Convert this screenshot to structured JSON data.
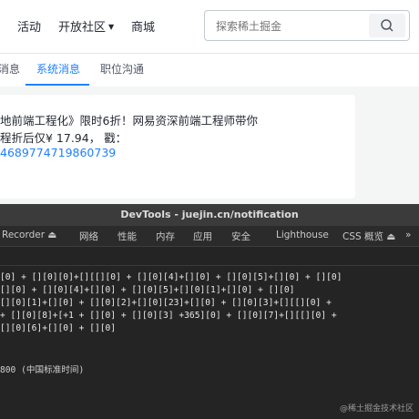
{
  "topnav": {
    "items": [
      {
        "label": "活动"
      },
      {
        "label": "开放社区"
      },
      {
        "label": "商城"
      }
    ],
    "search_placeholder": "探索稀土掘金"
  },
  "subnav": {
    "tabs": [
      {
        "label": "消息",
        "active": false
      },
      {
        "label": "系统消息",
        "active": true
      },
      {
        "label": "职位沟通",
        "active": false
      }
    ]
  },
  "card": {
    "line1": "地前端工程化》限时6折！网易资深前端工程师带你",
    "line2": "程折后仅¥ 17.94， 戳：",
    "link": "4689774719860739"
  },
  "devtools": {
    "title": "DevTools - juejin.cn/notification",
    "tabs": [
      {
        "label": "Recorder ⏏"
      },
      {
        "label": "网络"
      },
      {
        "label": "性能"
      },
      {
        "label": "内存"
      },
      {
        "label": "应用"
      },
      {
        "label": "安全"
      },
      {
        "label": "Lighthouse"
      },
      {
        "label": "CSS 概览 ⏏"
      },
      {
        "label": "»"
      }
    ],
    "code_lines": [
      "[0] + [][0][0]+[][[][0] + [][0][4]+[][0] + [][0][5]+[][0] + [][0]",
      "[][0] + [][0][4]+[][0] + [][0][5]+[][0][1]+[][0] + [][0]",
      "[][0][1]+[][0] + [][0][2]+[][0][23]+[][0] + [][0][3]+[][[][0] +",
      "+ [][0][8]+[+1 + [][0] + [][0][3] +365][0] + [][0][7]+[][[][0] +",
      "[][0][6]+[][0] + [][0]"
    ],
    "result": "800 (中国标准时间)"
  },
  "watermark": "@稀土掘金技术社区"
}
